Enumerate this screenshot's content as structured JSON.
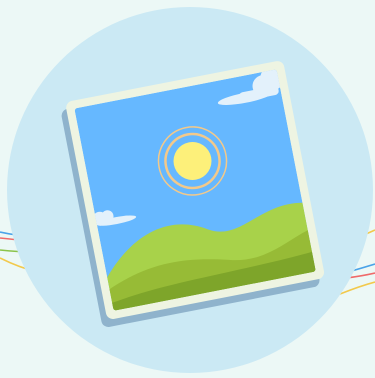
{
  "illustration": {
    "icon": "image-gallery-icon",
    "colors": {
      "page_background": "#ecf8f6",
      "circle": "#cbe9f4",
      "frame_shadow": "#8fb3cc",
      "frame_border": "#eef4e2",
      "sky": "#66b8ff",
      "sun": "#fdf07a",
      "sun_ring": "#f3c98a",
      "cloud": "#e3f1fb",
      "hill_back": "#a8d24a",
      "hill_front": "#97bb36",
      "hill_ground": "#7ea52a",
      "deco_line_red": "#ef6a6a",
      "deco_line_blue": "#4aa3e8",
      "deco_line_yellow": "#f2c94c",
      "deco_line_green": "#8bc34a"
    }
  }
}
